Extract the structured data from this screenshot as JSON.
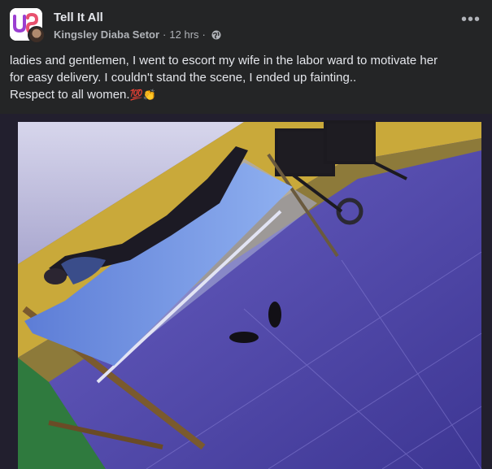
{
  "post": {
    "group_name": "Tell It All",
    "author": "Kingsley Diaba Setor",
    "time": "12 hrs",
    "separator": "·",
    "privacy_icon": "globe-icon",
    "more_icon": "more-options-icon",
    "more_label": "•••",
    "text_lines": [
      "ladies and gentlemen, I went to escort my wife in the labor ward to motivate her",
      "for easy delivery. I couldn't stand the scene, I ended up fainting..",
      "Respect to all women."
    ],
    "emoji_hundred": "💯",
    "emoji_clap": "👏",
    "colors": {
      "background": "#242526",
      "text_primary": "#e4e6eb",
      "text_secondary": "#b0b3b8",
      "logo_accent": "#9b3fd1"
    }
  }
}
